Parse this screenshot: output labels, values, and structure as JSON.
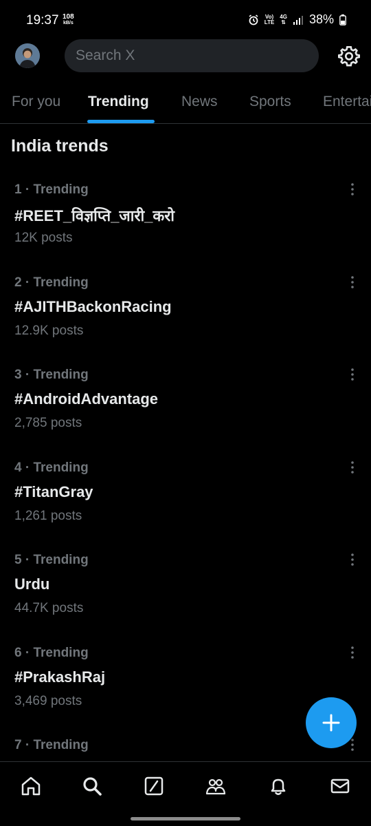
{
  "status_bar": {
    "time": "19:37",
    "speed_value": "108",
    "speed_unit": "kB/s",
    "net_volte": "Vo)",
    "net_lte": "LTE",
    "net_4g": "4G",
    "battery": "38%"
  },
  "header": {
    "search_placeholder": "Search X"
  },
  "tabs": [
    {
      "label": "For you",
      "active": false
    },
    {
      "label": "Trending",
      "active": true
    },
    {
      "label": "News",
      "active": false
    },
    {
      "label": "Sports",
      "active": false
    },
    {
      "label": "Entertainment",
      "active": false
    }
  ],
  "section_title": "India trends",
  "trends": [
    {
      "meta": "1 · Trending",
      "name": "#REET_विज्ञप्ति_जारी_करो",
      "posts": "12K posts"
    },
    {
      "meta": "2 · Trending",
      "name": "#AJITHBackonRacing",
      "posts": "12.9K posts"
    },
    {
      "meta": "3 · Trending",
      "name": "#AndroidAdvantage",
      "posts": "2,785 posts"
    },
    {
      "meta": "4 · Trending",
      "name": "#TitanGray",
      "posts": "1,261 posts"
    },
    {
      "meta": "5 · Trending",
      "name": "Urdu",
      "posts": "44.7K posts"
    },
    {
      "meta": "6 · Trending",
      "name": "#PrakashRaj",
      "posts": "3,469 posts"
    },
    {
      "meta": "7 · Trending",
      "name": "",
      "posts": ""
    }
  ],
  "icons": {
    "fab": "plus-icon",
    "nav": [
      "home-icon",
      "search-icon",
      "grok-icon",
      "communities-icon",
      "notifications-icon",
      "messages-icon"
    ]
  },
  "colors": {
    "accent": "#1d9bf0",
    "background": "#000000",
    "secondary_text": "#71767b"
  }
}
